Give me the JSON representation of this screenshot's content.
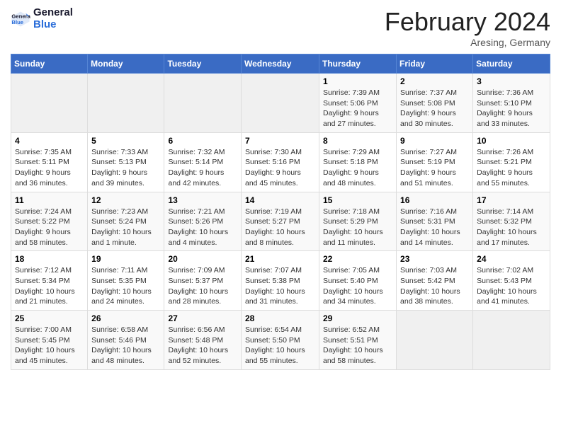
{
  "logo": {
    "line1": "General",
    "line2": "Blue"
  },
  "title": "February 2024",
  "location": "Aresing, Germany",
  "weekdays": [
    "Sunday",
    "Monday",
    "Tuesday",
    "Wednesday",
    "Thursday",
    "Friday",
    "Saturday"
  ],
  "weeks": [
    [
      {
        "day": "",
        "info": ""
      },
      {
        "day": "",
        "info": ""
      },
      {
        "day": "",
        "info": ""
      },
      {
        "day": "",
        "info": ""
      },
      {
        "day": "1",
        "info": "Sunrise: 7:39 AM\nSunset: 5:06 PM\nDaylight: 9 hours and 27 minutes."
      },
      {
        "day": "2",
        "info": "Sunrise: 7:37 AM\nSunset: 5:08 PM\nDaylight: 9 hours and 30 minutes."
      },
      {
        "day": "3",
        "info": "Sunrise: 7:36 AM\nSunset: 5:10 PM\nDaylight: 9 hours and 33 minutes."
      }
    ],
    [
      {
        "day": "4",
        "info": "Sunrise: 7:35 AM\nSunset: 5:11 PM\nDaylight: 9 hours and 36 minutes."
      },
      {
        "day": "5",
        "info": "Sunrise: 7:33 AM\nSunset: 5:13 PM\nDaylight: 9 hours and 39 minutes."
      },
      {
        "day": "6",
        "info": "Sunrise: 7:32 AM\nSunset: 5:14 PM\nDaylight: 9 hours and 42 minutes."
      },
      {
        "day": "7",
        "info": "Sunrise: 7:30 AM\nSunset: 5:16 PM\nDaylight: 9 hours and 45 minutes."
      },
      {
        "day": "8",
        "info": "Sunrise: 7:29 AM\nSunset: 5:18 PM\nDaylight: 9 hours and 48 minutes."
      },
      {
        "day": "9",
        "info": "Sunrise: 7:27 AM\nSunset: 5:19 PM\nDaylight: 9 hours and 51 minutes."
      },
      {
        "day": "10",
        "info": "Sunrise: 7:26 AM\nSunset: 5:21 PM\nDaylight: 9 hours and 55 minutes."
      }
    ],
    [
      {
        "day": "11",
        "info": "Sunrise: 7:24 AM\nSunset: 5:22 PM\nDaylight: 9 hours and 58 minutes."
      },
      {
        "day": "12",
        "info": "Sunrise: 7:23 AM\nSunset: 5:24 PM\nDaylight: 10 hours and 1 minute."
      },
      {
        "day": "13",
        "info": "Sunrise: 7:21 AM\nSunset: 5:26 PM\nDaylight: 10 hours and 4 minutes."
      },
      {
        "day": "14",
        "info": "Sunrise: 7:19 AM\nSunset: 5:27 PM\nDaylight: 10 hours and 8 minutes."
      },
      {
        "day": "15",
        "info": "Sunrise: 7:18 AM\nSunset: 5:29 PM\nDaylight: 10 hours and 11 minutes."
      },
      {
        "day": "16",
        "info": "Sunrise: 7:16 AM\nSunset: 5:31 PM\nDaylight: 10 hours and 14 minutes."
      },
      {
        "day": "17",
        "info": "Sunrise: 7:14 AM\nSunset: 5:32 PM\nDaylight: 10 hours and 17 minutes."
      }
    ],
    [
      {
        "day": "18",
        "info": "Sunrise: 7:12 AM\nSunset: 5:34 PM\nDaylight: 10 hours and 21 minutes."
      },
      {
        "day": "19",
        "info": "Sunrise: 7:11 AM\nSunset: 5:35 PM\nDaylight: 10 hours and 24 minutes."
      },
      {
        "day": "20",
        "info": "Sunrise: 7:09 AM\nSunset: 5:37 PM\nDaylight: 10 hours and 28 minutes."
      },
      {
        "day": "21",
        "info": "Sunrise: 7:07 AM\nSunset: 5:38 PM\nDaylight: 10 hours and 31 minutes."
      },
      {
        "day": "22",
        "info": "Sunrise: 7:05 AM\nSunset: 5:40 PM\nDaylight: 10 hours and 34 minutes."
      },
      {
        "day": "23",
        "info": "Sunrise: 7:03 AM\nSunset: 5:42 PM\nDaylight: 10 hours and 38 minutes."
      },
      {
        "day": "24",
        "info": "Sunrise: 7:02 AM\nSunset: 5:43 PM\nDaylight: 10 hours and 41 minutes."
      }
    ],
    [
      {
        "day": "25",
        "info": "Sunrise: 7:00 AM\nSunset: 5:45 PM\nDaylight: 10 hours and 45 minutes."
      },
      {
        "day": "26",
        "info": "Sunrise: 6:58 AM\nSunset: 5:46 PM\nDaylight: 10 hours and 48 minutes."
      },
      {
        "day": "27",
        "info": "Sunrise: 6:56 AM\nSunset: 5:48 PM\nDaylight: 10 hours and 52 minutes."
      },
      {
        "day": "28",
        "info": "Sunrise: 6:54 AM\nSunset: 5:50 PM\nDaylight: 10 hours and 55 minutes."
      },
      {
        "day": "29",
        "info": "Sunrise: 6:52 AM\nSunset: 5:51 PM\nDaylight: 10 hours and 58 minutes."
      },
      {
        "day": "",
        "info": ""
      },
      {
        "day": "",
        "info": ""
      }
    ]
  ]
}
